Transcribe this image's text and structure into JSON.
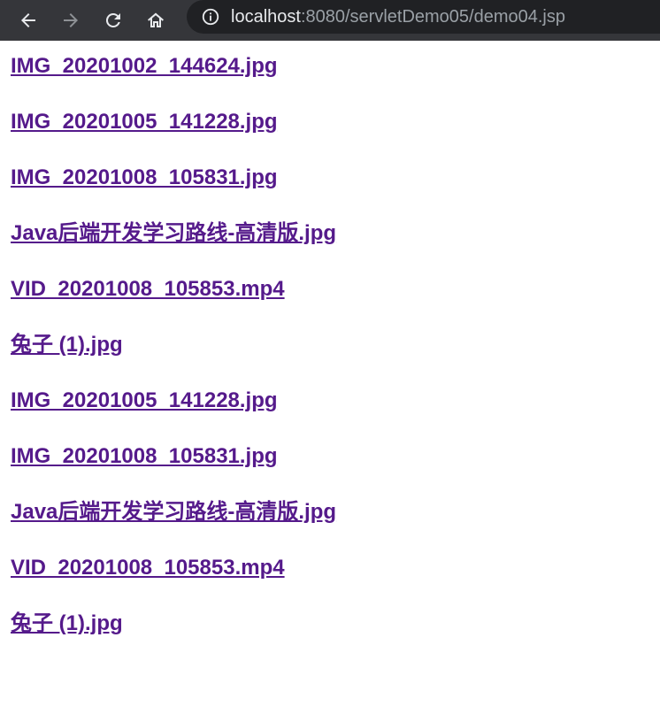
{
  "browser": {
    "url_host": "localhost",
    "url_rest": ":8080/servletDemo05/demo04.jsp",
    "icons": {
      "back": "back-arrow-icon",
      "forward": "forward-arrow-icon",
      "reload": "reload-icon",
      "home": "home-icon",
      "info": "info-icon"
    }
  },
  "files": [
    "IMG_20201002_144624.jpg",
    "IMG_20201005_141228.jpg",
    "IMG_20201008_105831.jpg",
    "Java后端开发学习路线-高清版.jpg",
    "VID_20201008_105853.mp4",
    "兔子 (1).jpg",
    "IMG_20201005_141228.jpg",
    "IMG_20201008_105831.jpg",
    "Java后端开发学习路线-高清版.jpg",
    "VID_20201008_105853.mp4",
    "兔子 (1).jpg"
  ],
  "colors": {
    "toolbar_bg": "#35363a",
    "omnibox_bg": "#202124",
    "visited_link": "#551a8b"
  }
}
